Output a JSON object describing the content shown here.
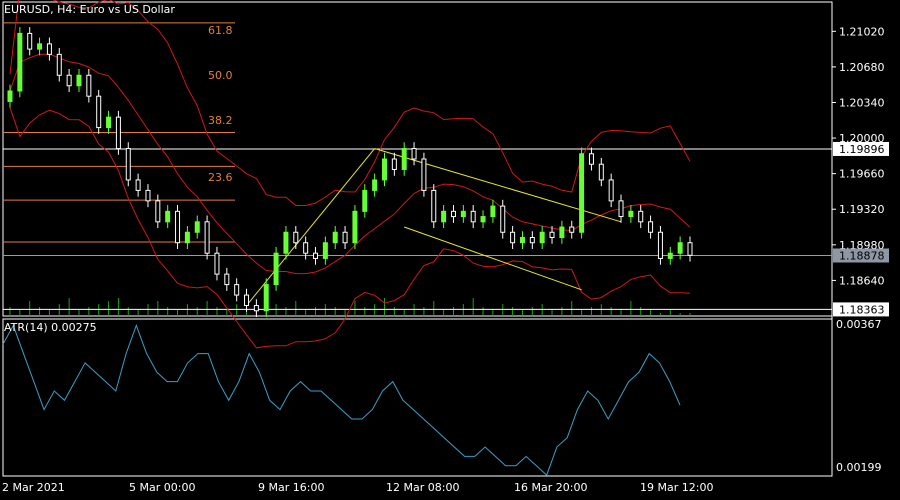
{
  "header": {
    "symbol": "EURUSD, H4:",
    "description": "Euro vs US Dollar"
  },
  "colors": {
    "background": "#000000",
    "grid": "#ffffff",
    "bull_candle": "#66ff33",
    "bear_candle": "#ffffff",
    "bollinger": "#d01818",
    "fibo": "#e0803a",
    "trendline": "#e8e82a",
    "atr": "#3aa0c8",
    "volume": "#1fa01f",
    "hline": "#ffffff"
  },
  "price_axis": {
    "ticks": [
      "1.21020",
      "1.20680",
      "1.20340",
      "1.20000",
      "1.19660",
      "1.19320",
      "1.18980",
      "1.18640"
    ],
    "markers": [
      {
        "price": "1.19896",
        "style": "white"
      },
      {
        "price": "1.18878",
        "style": "grey"
      },
      {
        "price": "1.18363",
        "style": "white"
      }
    ]
  },
  "fibonacci": {
    "levels": [
      "61.8",
      "50.0",
      "38.2",
      "23.6"
    ]
  },
  "indicator": {
    "title": "ATR(14) 0.00275",
    "axis_top": "0.00367",
    "axis_bottom": "0.00199"
  },
  "time_axis": {
    "labels": [
      "2 Mar 2021",
      "5 Mar 00:00",
      "9 Mar 16:00",
      "12 Mar 08:00",
      "16 Mar 20:00",
      "19 Mar 12:00"
    ]
  },
  "chart_data": {
    "type": "candlestick",
    "price_range": [
      1.183,
      1.213
    ],
    "closes": [
      1.2045,
      1.21,
      1.2085,
      1.209,
      1.208,
      1.206,
      1.205,
      1.206,
      1.204,
      1.201,
      1.202,
      1.199,
      1.196,
      1.195,
      1.194,
      1.192,
      1.193,
      1.19,
      1.191,
      1.192,
      1.189,
      1.187,
      1.186,
      1.185,
      1.184,
      1.1835,
      1.186,
      1.189,
      1.191,
      1.19,
      1.189,
      1.1885,
      1.19,
      1.191,
      1.19,
      1.193,
      1.195,
      1.196,
      1.198,
      1.197,
      1.199,
      1.198,
      1.195,
      1.192,
      1.193,
      1.1925,
      1.193,
      1.192,
      1.1925,
      1.1935,
      1.191,
      1.19,
      1.1905,
      1.19,
      1.191,
      1.1905,
      1.1915,
      1.191,
      1.1985,
      1.1975,
      1.196,
      1.194,
      1.1925,
      1.193,
      1.192,
      1.191,
      1.1885,
      1.189,
      1.19,
      1.1888
    ],
    "atr_values": [
      0.0034,
      0.0036,
      0.0033,
      0.003,
      0.0027,
      0.0029,
      0.0028,
      0.003,
      0.0032,
      0.0031,
      0.003,
      0.0029,
      0.0033,
      0.0036,
      0.0033,
      0.0031,
      0.003,
      0.003,
      0.0032,
      0.0033,
      0.0033,
      0.003,
      0.0028,
      0.003,
      0.0033,
      0.0031,
      0.0028,
      0.0027,
      0.0029,
      0.003,
      0.0029,
      0.0029,
      0.0028,
      0.0027,
      0.0026,
      0.0026,
      0.0027,
      0.0029,
      0.003,
      0.0028,
      0.0027,
      0.0026,
      0.0025,
      0.0024,
      0.0023,
      0.0022,
      0.0022,
      0.0023,
      0.0022,
      0.0021,
      0.0021,
      0.0022,
      0.0021,
      0.002,
      0.0023,
      0.0024,
      0.0027,
      0.0029,
      0.0028,
      0.0026,
      0.0028,
      0.003,
      0.0031,
      0.0033,
      0.0032,
      0.003,
      0.00275
    ],
    "volumes": [
      3,
      2,
      5,
      3,
      2,
      4,
      6,
      2,
      3,
      4,
      5,
      6,
      3,
      2,
      4,
      5,
      3,
      2,
      4,
      3,
      5,
      3,
      2,
      4,
      6,
      3,
      2,
      4,
      3,
      5,
      2,
      3,
      4,
      3,
      2,
      5,
      3,
      4,
      6,
      3,
      2,
      4,
      3,
      5,
      2,
      3,
      4,
      6,
      3,
      2,
      4,
      3,
      2,
      3,
      4,
      2,
      3,
      5,
      2,
      3,
      4,
      3,
      2,
      5,
      3,
      2,
      1,
      2,
      1,
      1
    ]
  }
}
